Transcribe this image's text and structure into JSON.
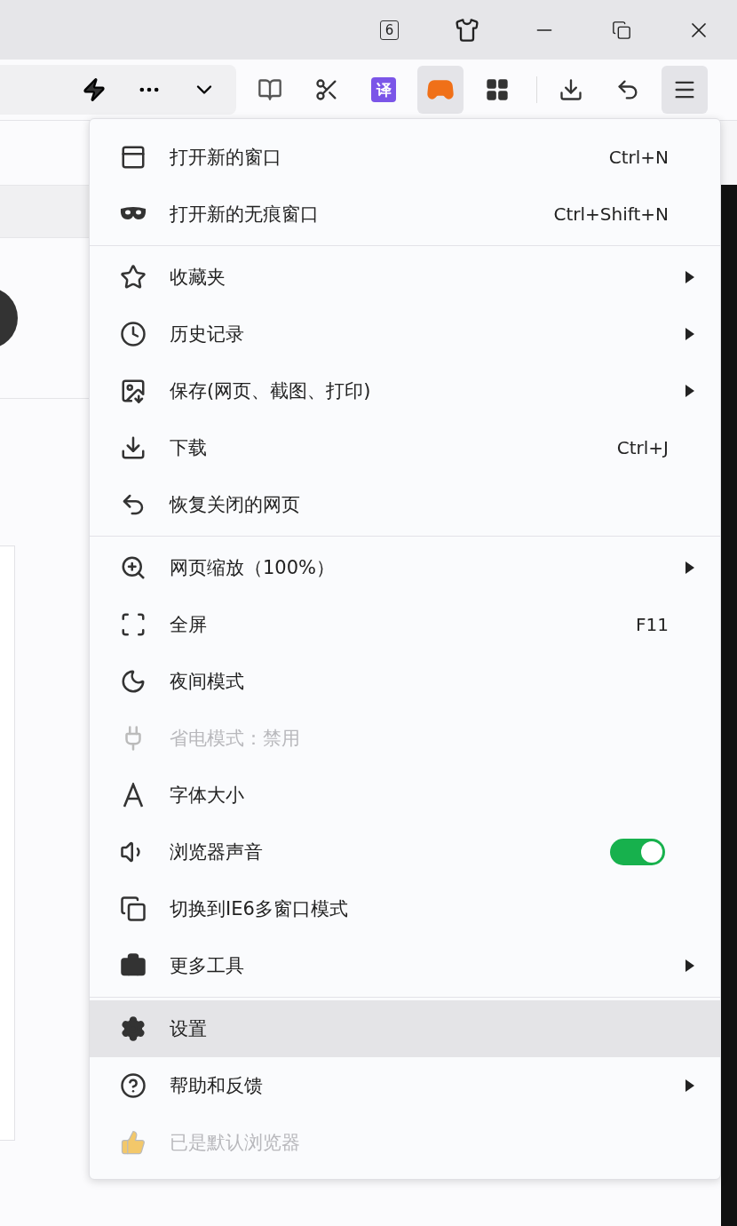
{
  "title_bar": {
    "tab_count": "6"
  },
  "toolbar": {
    "buttons": [
      {
        "selected": false
      },
      {
        "selected": false
      },
      {
        "selected": false
      },
      {
        "selected": false
      },
      {
        "selected": false
      },
      {
        "selected": false,
        "label": "译"
      },
      {
        "selected": true
      },
      {
        "selected": false
      },
      {
        "selected": false
      },
      {
        "selected": false
      },
      {
        "selected": true
      }
    ]
  },
  "menu": {
    "sections": [
      {
        "items": [
          {
            "kind": "shortcut",
            "label": "打开新的窗口",
            "shortcut": "Ctrl+N",
            "selected": false,
            "disabled": false
          },
          {
            "kind": "shortcut",
            "label": "打开新的无痕窗口",
            "shortcut": "Ctrl+Shift+N",
            "selected": false,
            "disabled": false
          }
        ]
      },
      {
        "items": [
          {
            "kind": "submenu",
            "label": "收藏夹",
            "selected": false,
            "disabled": false
          },
          {
            "kind": "submenu",
            "label": "历史记录",
            "selected": false,
            "disabled": false
          },
          {
            "kind": "submenu",
            "label": "保存(网页、截图、打印)",
            "selected": false,
            "disabled": false
          },
          {
            "kind": "shortcut",
            "label": "下载",
            "shortcut": "Ctrl+J",
            "selected": false,
            "disabled": false
          },
          {
            "kind": "plain",
            "label": "恢复关闭的网页",
            "selected": false,
            "disabled": false
          }
        ]
      },
      {
        "items": [
          {
            "kind": "submenu",
            "label": "网页缩放（100%）",
            "selected": false,
            "disabled": false
          },
          {
            "kind": "shortcut",
            "label": "全屏",
            "shortcut": "F11",
            "selected": false,
            "disabled": false
          },
          {
            "kind": "plain",
            "label": "夜间模式",
            "selected": false,
            "disabled": false
          },
          {
            "kind": "plain",
            "label": "省电模式：禁用",
            "selected": false,
            "disabled": true
          },
          {
            "kind": "plain",
            "label": "字体大小",
            "selected": false,
            "disabled": false
          },
          {
            "kind": "toggle",
            "label": "浏览器声音",
            "on": true,
            "selected": false,
            "disabled": false
          },
          {
            "kind": "plain",
            "label": "切换到IE6多窗口模式",
            "selected": false,
            "disabled": false
          },
          {
            "kind": "submenu",
            "label": "更多工具",
            "selected": false,
            "disabled": false
          }
        ]
      },
      {
        "items": [
          {
            "kind": "plain",
            "label": "设置",
            "selected": true,
            "disabled": false
          },
          {
            "kind": "submenu",
            "label": "帮助和反馈",
            "selected": false,
            "disabled": false
          },
          {
            "kind": "plain",
            "label": "已是默认浏览器",
            "selected": false,
            "disabled": true
          }
        ]
      }
    ]
  }
}
